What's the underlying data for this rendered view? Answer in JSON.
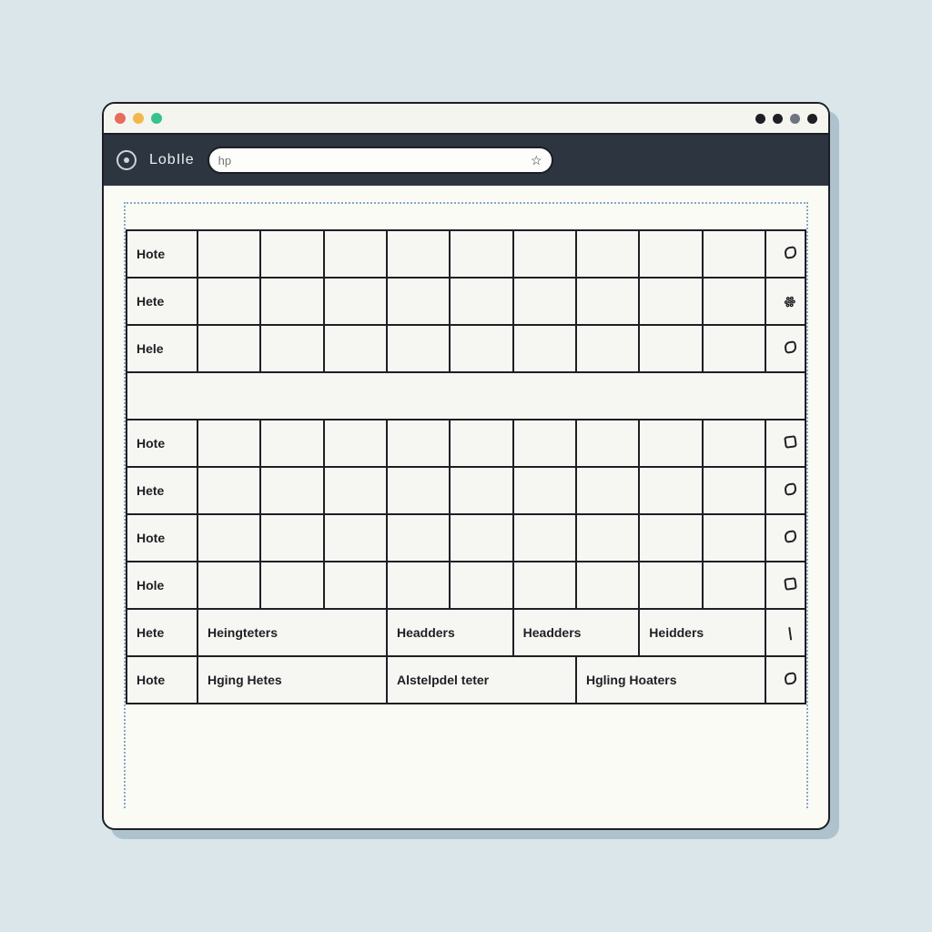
{
  "brand": "LobIle",
  "address_placeholder": "hp",
  "rows_top": [
    {
      "label": "Hote",
      "mark": "leaf"
    },
    {
      "label": "Hete",
      "mark": "sl"
    },
    {
      "label": "Hele",
      "mark": "leaf"
    }
  ],
  "rows_mid": [
    {
      "label": "Hote",
      "mark": "box"
    },
    {
      "label": "Hete",
      "mark": "leaf"
    },
    {
      "label": "Hote",
      "mark": "leaf"
    },
    {
      "label": "Hole",
      "mark": "box"
    }
  ],
  "row_headers": {
    "label": "Hete",
    "cells": [
      "Heingteters",
      "Headders",
      "Headders",
      "Heidders"
    ],
    "mark": "|"
  },
  "row_footer": {
    "label": "Hote",
    "cells": [
      "Hging Hetes",
      "Alstelpdel teter",
      "Hgling Hoaters"
    ],
    "mark": "leaf"
  }
}
